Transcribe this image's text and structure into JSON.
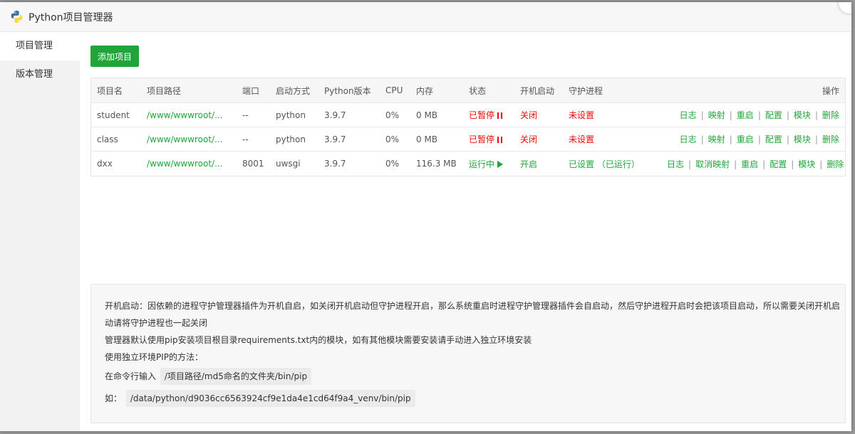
{
  "window": {
    "title": "Python项目管理器"
  },
  "sidebar": {
    "items": [
      {
        "label": "项目管理"
      },
      {
        "label": "版本管理"
      }
    ]
  },
  "toolbar": {
    "add_label": "添加项目"
  },
  "table": {
    "headers": [
      "项目名",
      "项目路径",
      "端口",
      "启动方式",
      "Python版本",
      "CPU",
      "内存",
      "状态",
      "开机启动",
      "守护进程",
      "操作"
    ],
    "rows": [
      {
        "name": "student",
        "path": "/www/wwwroot/...",
        "port": "--",
        "mode": "python",
        "version": "3.9.7",
        "cpu": "0%",
        "mem": "0 MB",
        "status": "已暂停",
        "status_kind": "paused",
        "boot": "关闭",
        "daemon": "未设置",
        "daemon_extra": "",
        "ops": [
          "日志",
          "映射",
          "重启",
          "配置",
          "模块",
          "删除"
        ]
      },
      {
        "name": "class",
        "path": "/www/wwwroot/...",
        "port": "--",
        "mode": "python",
        "version": "3.9.7",
        "cpu": "0%",
        "mem": "0 MB",
        "status": "已暂停",
        "status_kind": "paused",
        "boot": "关闭",
        "daemon": "未设置",
        "daemon_extra": "",
        "ops": [
          "日志",
          "映射",
          "重启",
          "配置",
          "模块",
          "删除"
        ]
      },
      {
        "name": "dxx",
        "path": "/www/wwwroot/...",
        "port": "8001",
        "mode": "uwsgi",
        "version": "3.9.7",
        "cpu": "0%",
        "mem": "116.3 MB",
        "status": "运行中",
        "status_kind": "running",
        "boot": "开启",
        "daemon": "已设置",
        "daemon_extra": "（已运行）",
        "ops": [
          "日志",
          "取消映射",
          "重启",
          "配置",
          "模块",
          "删除"
        ]
      }
    ]
  },
  "help": {
    "line1": "开机启动：因依赖的进程守护管理器插件为开机自启，如关闭开机启动但守护进程开启，那么系统重启时进程守护管理器插件会自启动，然后守护进程开启时会把该项目启动，所以需要关闭开机启",
    "line2": "动请将守护进程也一起关闭",
    "line3": "管理器默认使用pip安装项目根目录requirements.txt内的模块，如有其他模块需要安装请手动进入独立环境安装",
    "line4": "使用独立环境PIP的方法：",
    "line5_prefix": "在命令行输入",
    "line5_code": "/项目路径/md5命名的文件夹/bin/pip",
    "line6_prefix": "如：",
    "line6_code": "/data/python/d9036cc6563924cf9e1da4e1cd64f9a4_venv/bin/pip"
  },
  "colors": {
    "accent": "#20a53a",
    "danger": "#ef0808"
  }
}
